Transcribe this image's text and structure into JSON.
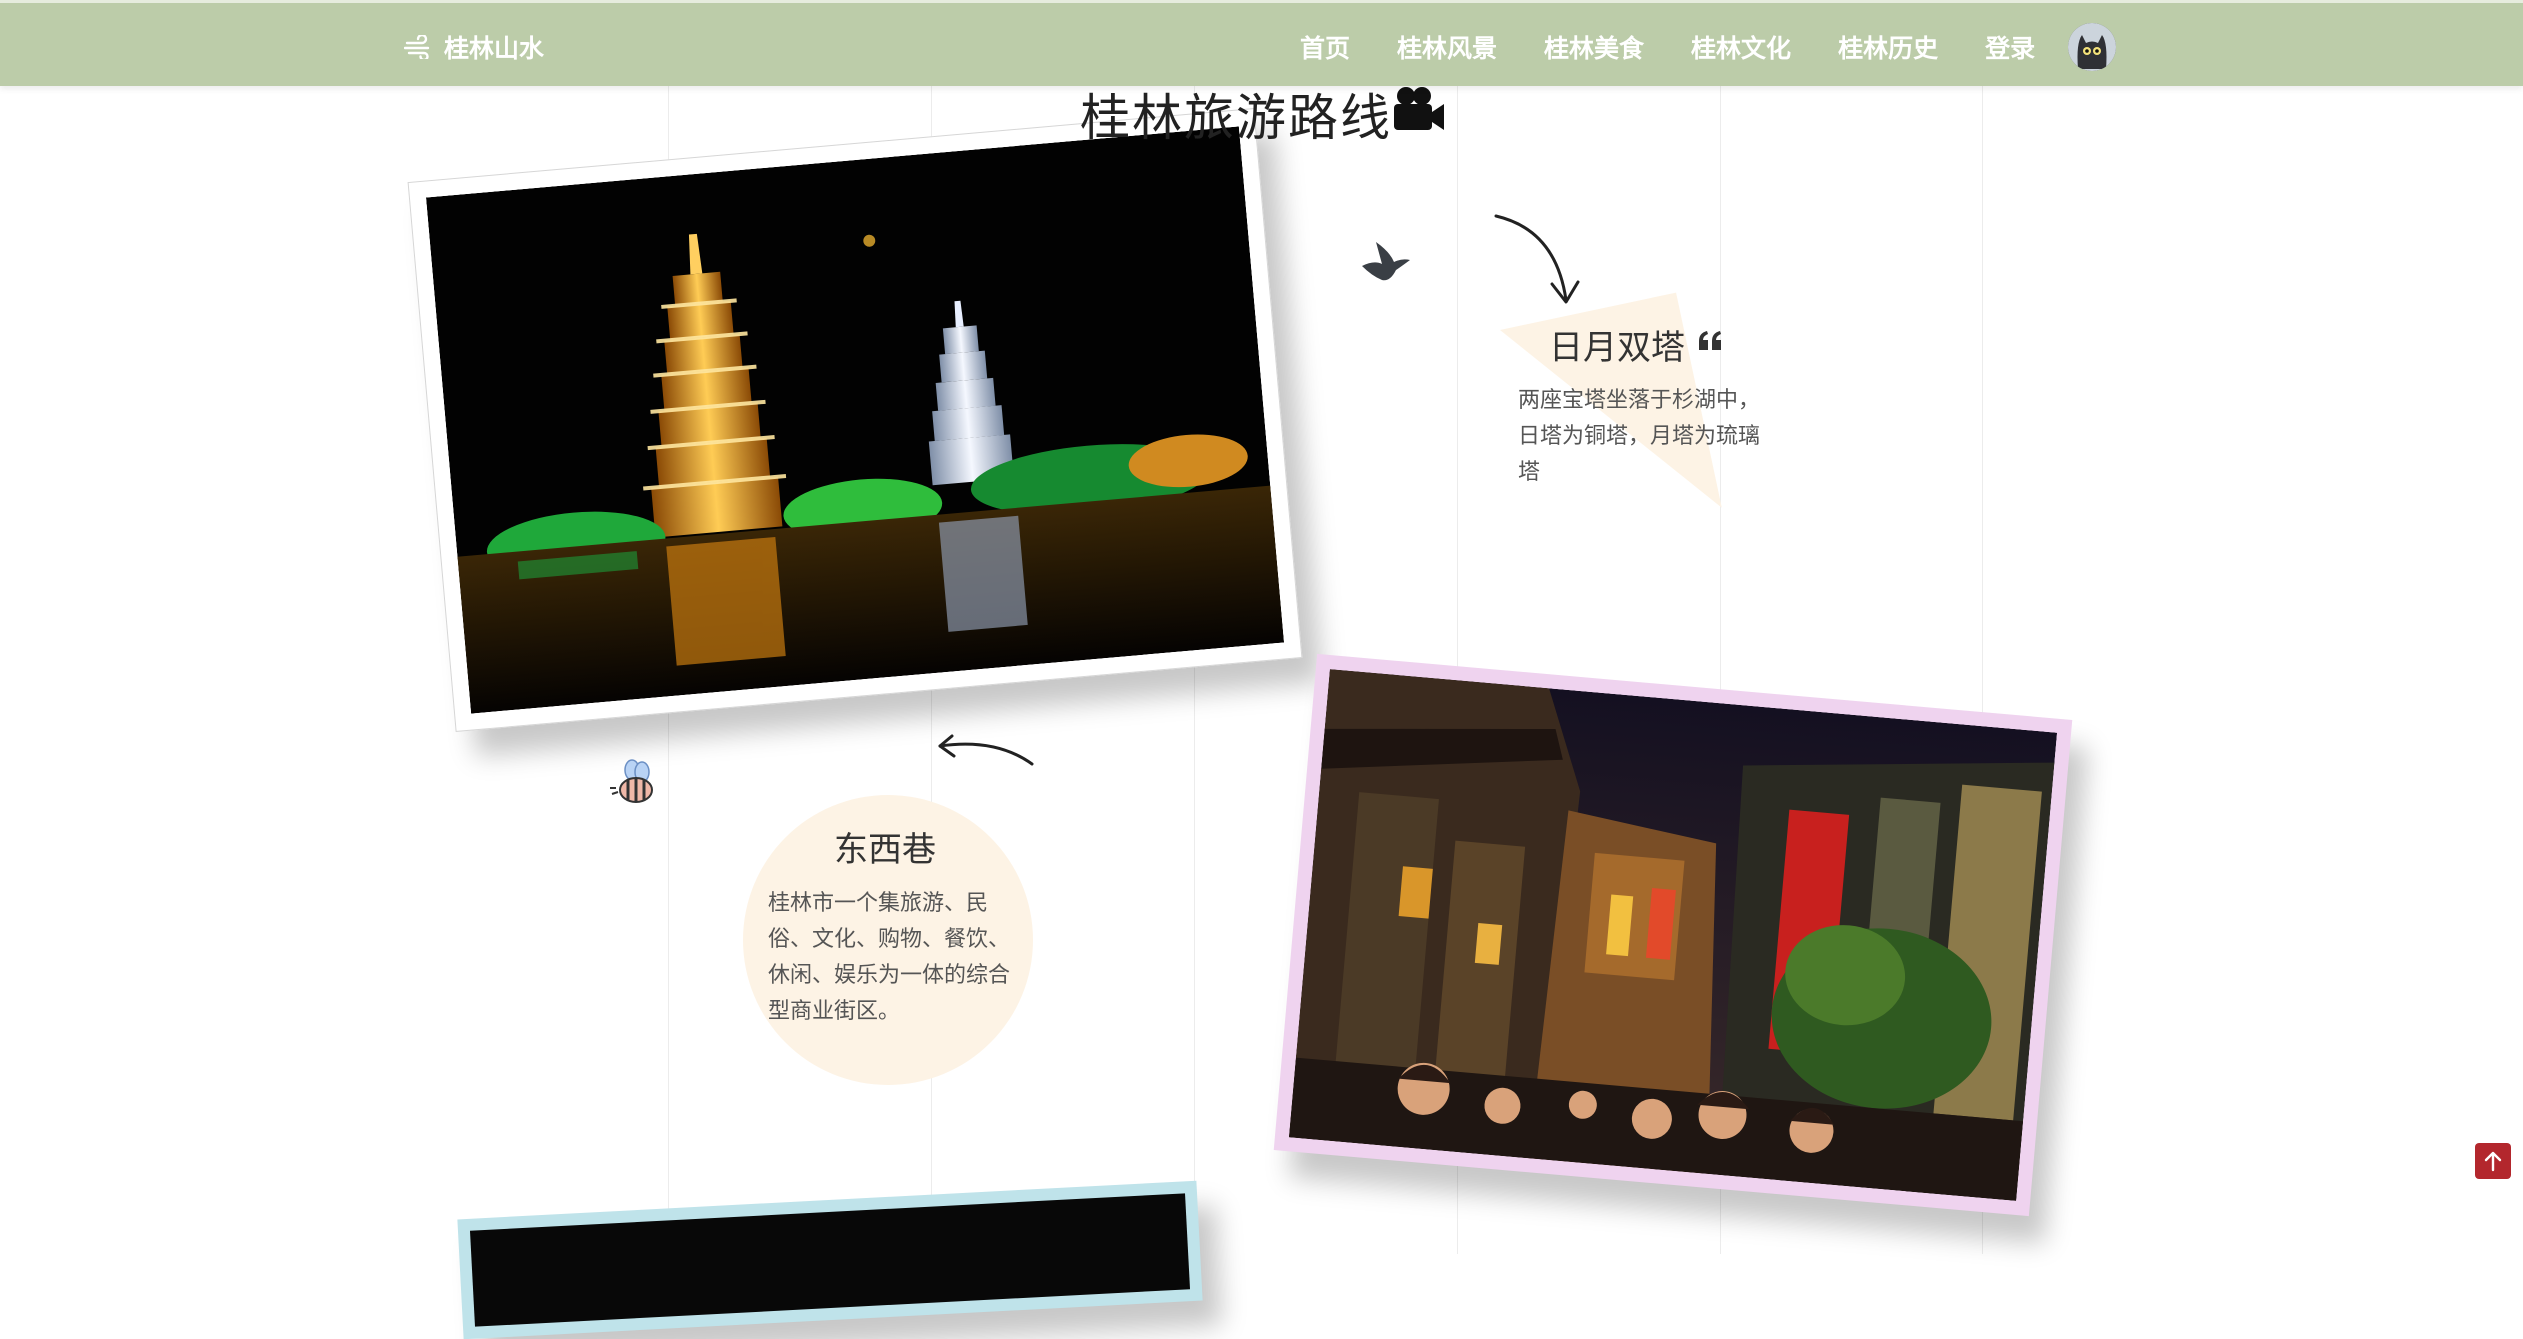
{
  "nav": {
    "brand": "桂林山水",
    "links": [
      "首页",
      "桂林风景",
      "桂林美食",
      "桂林文化",
      "桂林历史",
      "登录"
    ]
  },
  "section": {
    "title": "桂林旅游路线"
  },
  "spots": [
    {
      "title": "日月双塔",
      "desc": "两座宝塔坐落于杉湖中，日塔为铜塔，月塔为琉璃塔"
    },
    {
      "title": "东西巷",
      "desc": "桂林市一个集旅游、民俗、文化、购物、餐饮、休闲、娱乐为一体的综合型商业街区。"
    }
  ],
  "colors": {
    "navbar_bg": "#bccca9",
    "accent_cream": "#fdf3e5",
    "photo2_frame": "#efd3ef",
    "photo3_frame": "#bfe3ea",
    "back_top": "#b3272d"
  },
  "icons": [
    "wind-icon",
    "cat-avatar",
    "camera-icon",
    "bird-icon",
    "curved-arrow-icon",
    "quote-icon",
    "bee-icon",
    "arrow-up-icon"
  ]
}
